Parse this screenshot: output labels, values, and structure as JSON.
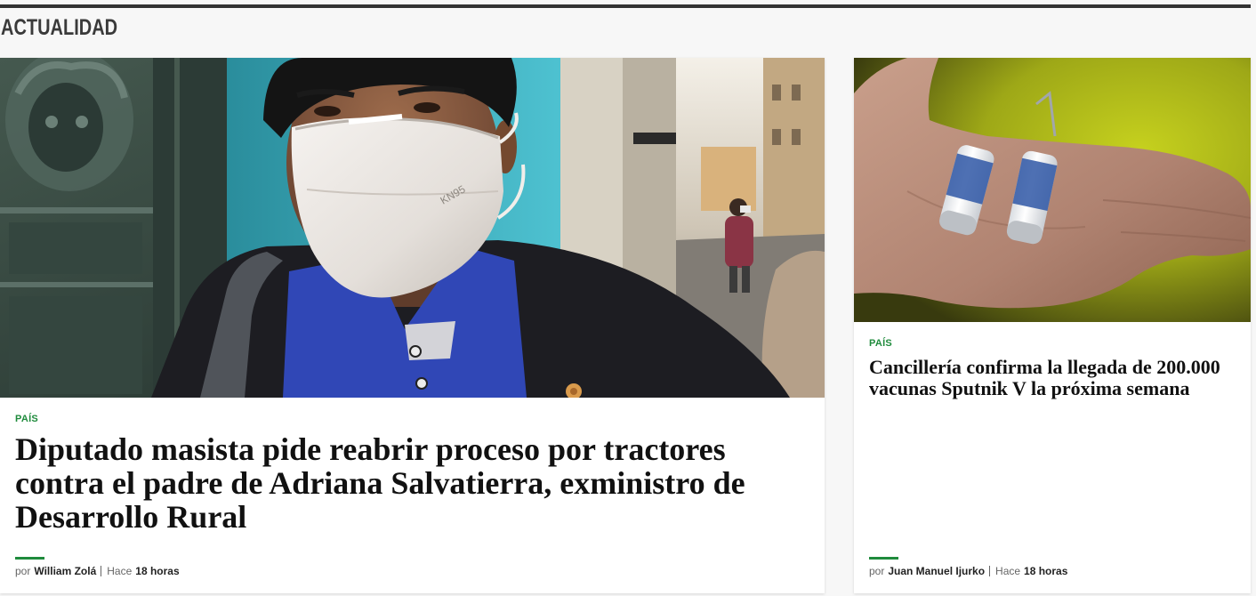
{
  "section": {
    "title": "ACTUALIDAD"
  },
  "colors": {
    "accent": "#1f8b3c",
    "rule": "#333333",
    "section": "#3a3a3a",
    "headline": "#111111",
    "meta": "#666666"
  },
  "articles": [
    {
      "category": "PAÍS",
      "headline": "Diputado masista pide reabrir proceso por tractores contra el padre de Adriana Salvatierra, exministro de Desarrollo Rural",
      "photo_text": "KN95",
      "byline": {
        "prefix": "por",
        "author": "William Zolá",
        "time_prefix": "Hace",
        "time": "18 horas"
      }
    },
    {
      "category": "PAÍS",
      "headline": "Cancillería confirma la llegada de 200.000 vacunas Sputnik V la próxima semana",
      "byline": {
        "prefix": "por",
        "author": "Juan Manuel Ijurko",
        "time_prefix": "Hace",
        "time": "18 horas"
      }
    }
  ]
}
